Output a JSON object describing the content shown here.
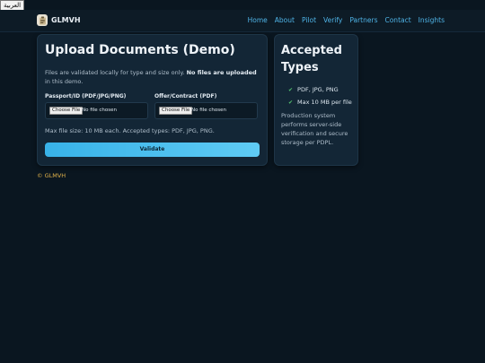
{
  "language_toggle": {
    "label": "العربية"
  },
  "brand": {
    "name": "GLMVH",
    "logo_icon": "clipboard-icon"
  },
  "nav": {
    "links": [
      "Home",
      "About",
      "Pilot",
      "Verify",
      "Partners",
      "Contact",
      "Insights"
    ],
    "link_color": "#4fb3e6"
  },
  "upload": {
    "title": "Upload Documents (Demo)",
    "intro_text": "Files are validated locally for type and size only.",
    "intro_bold": "No files are uploaded",
    "intro_tail": "in this demo.",
    "fields": [
      {
        "label": "Passport/ID (PDF/JPG/PNG)",
        "button": "Choose File",
        "status": "No file chosen"
      },
      {
        "label": "Offer/Contract (PDF)",
        "button": "Choose File",
        "status": "No file chosen"
      }
    ],
    "max_size_note": "Max file size: 10 MB each. Accepted types: PDF, JPG, PNG.",
    "validate_label": "Validate"
  },
  "accepted": {
    "title": "Accepted Types",
    "items": [
      "PDF, JPG, PNG",
      "Max 10 MB per file"
    ],
    "check_icon": "check-icon",
    "note": "Production system performs server-side verification and secure storage per PDPL."
  },
  "footer": {
    "text": "© GLMVH"
  },
  "colors": {
    "background": "#0a1620",
    "card": "#132636",
    "accent": "#38b2e8",
    "footer_text": "#e0b14a",
    "check": "#54c36f"
  }
}
